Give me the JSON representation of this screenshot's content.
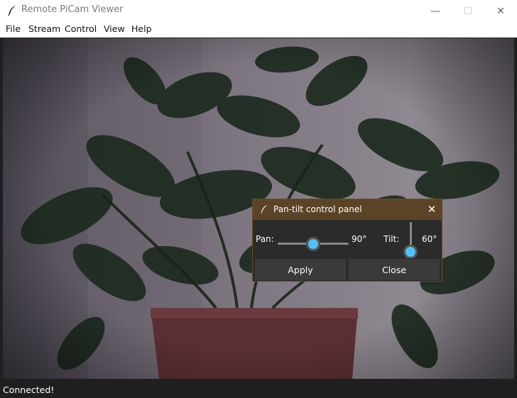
{
  "window": {
    "title": "Remote PiCam Viewer",
    "minimize_glyph": "—",
    "maximize_glyph": "☐",
    "close_glyph": "✕"
  },
  "menu": {
    "items": [
      {
        "label": "File"
      },
      {
        "label": "Stream"
      },
      {
        "label": "Control"
      },
      {
        "label": "View"
      },
      {
        "label": "Help"
      }
    ]
  },
  "status": {
    "text": "Connected!"
  },
  "dialog": {
    "title": "Pan-tilt control panel",
    "close_glyph": "✕",
    "pan": {
      "label": "Pan:",
      "value_text": "90°",
      "value": 90,
      "min": 0,
      "max": 180
    },
    "tilt": {
      "label": "Tilt:",
      "value_text": "60°",
      "value": 60,
      "min": 0,
      "max": 60
    },
    "apply_label": "Apply",
    "close_label": "Close",
    "colors": {
      "title_bar": "#5b4327",
      "slider_knob": "#4fc3f7"
    }
  },
  "icons": {
    "app": "feather-icon",
    "dialog": "feather-icon"
  }
}
